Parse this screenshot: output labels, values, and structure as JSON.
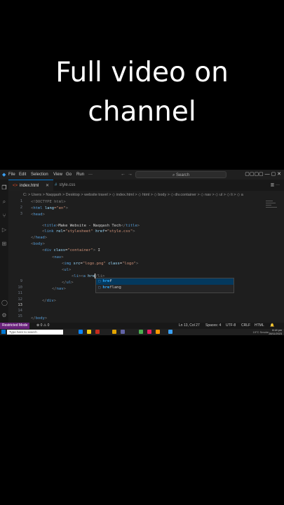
{
  "caption": {
    "line1": "Full video on",
    "line2": "channel"
  },
  "menubar": {
    "items": [
      "File",
      "Edit",
      "Selection",
      "View",
      "Go",
      "Run",
      "···"
    ],
    "search_placeholder": "Search",
    "nav_back": "←",
    "nav_forward": "→",
    "window_controls": "▢▢▢▢  —  ▢  ✕"
  },
  "tabs": [
    {
      "label": "index.html",
      "active": true,
      "close": "✕"
    },
    {
      "label": "style.css",
      "active": false
    }
  ],
  "tab_actions": "▥ ···",
  "breadcrumb": "C: > Users > Naqqash > Desktop > website travel > ◇ index.html > ◇ html > ◇ body > ◇ div.container > ◇ nav > ◇ ul > ◇ li > ◇ a",
  "line_numbers": [
    "1",
    "2",
    "3",
    "",
    "",
    "",
    "",
    "",
    "9",
    "10",
    "11",
    "12",
    "13",
    "14",
    "15",
    "",
    "",
    "18",
    "",
    "20"
  ],
  "code": {
    "l1": [
      "<!DOCTYPE html>"
    ],
    "l2": [
      "<",
      "html",
      " lang",
      "=\"en\"",
      ">"
    ],
    "l3": [
      "<",
      "head",
      ">"
    ],
    "l4": [
      "<",
      "title",
      ">",
      "Make Website - Naqqash Tech",
      "</",
      "title",
      ">"
    ],
    "l5": [
      "<",
      "link",
      " rel",
      "=",
      "\"stylesheet\"",
      " href",
      "=",
      "\"style.css\"",
      ">"
    ],
    "l6": [
      "</",
      "head",
      ">"
    ],
    "l7": [
      "<",
      "body",
      ">"
    ],
    "l8": [
      "<",
      "div",
      " class",
      "=",
      "\"container\"",
      ">"
    ],
    "l9": [
      "<",
      "nav",
      ">"
    ],
    "l10": [
      "<",
      "img",
      " src",
      "=",
      "\"logo.png\"",
      " class",
      "=",
      "\"logo\"",
      ">"
    ],
    "l11": [
      "<",
      "ul",
      ">"
    ],
    "l12": [
      "<",
      "li",
      "><",
      "a",
      " hre",
      "",
      "/li>"
    ],
    "l13": [
      "</",
      "ul",
      ">"
    ],
    "l14": [
      "</",
      "nav",
      ">"
    ],
    "l15": [
      "</",
      "div",
      ">"
    ],
    "l16": [
      "</",
      "body",
      ">"
    ]
  },
  "suggestions": [
    {
      "prefix": "hre",
      "rest": "f",
      "selected": true
    },
    {
      "prefix": "hre",
      "rest": "flang",
      "selected": false
    }
  ],
  "statusbar": {
    "restricted": "Restricted Mode",
    "problems": "⊗ 0 ⚠ 0",
    "position": "Ln 13, Col 27",
    "spaces": "Spaces: 4",
    "encoding": "UTF-8",
    "eol": "CRLF",
    "language": "HTML"
  },
  "taskbar": {
    "search": "Type here to search",
    "weather": "19°C Smoke",
    "time": "8:18 pm",
    "date": "28/11/2023"
  },
  "colors": {
    "accent": "#0078d4",
    "restricted_bg": "#68217a",
    "keyword": "#569cd6",
    "attr": "#9cdcfe",
    "string": "#ce9178"
  }
}
